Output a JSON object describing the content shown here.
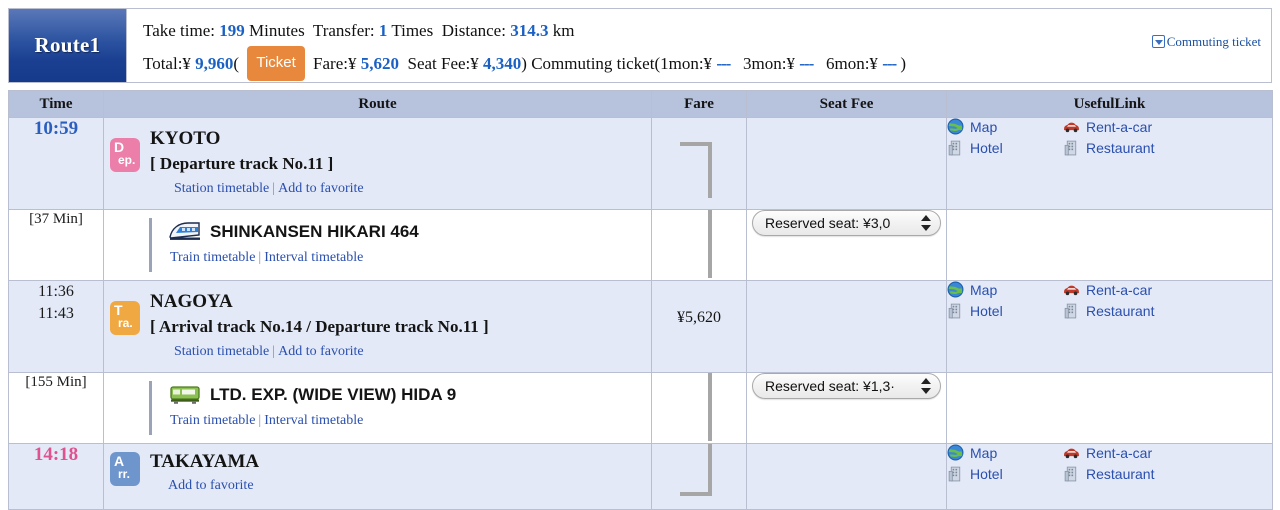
{
  "summary": {
    "route_label": "Route1",
    "take_time_label": "Take time:",
    "take_time_value": "199",
    "take_time_unit": "Minutes",
    "transfer_label": "Transfer:",
    "transfer_value": "1",
    "transfer_unit": "Times",
    "distance_label": "Distance:",
    "distance_value": "314.3",
    "distance_unit": "km",
    "total_label": "Total:¥",
    "total_value": "9,960",
    "open_paren": "(",
    "ticket_chip": "Ticket",
    "fare_label": "Fare:¥",
    "fare_value": "5,620",
    "seatfee_label": "Seat Fee:¥",
    "seatfee_value": "4,340",
    "close_paren": ")",
    "commuting_prefix": "Commuting ticket(1mon:¥",
    "commuting_1mon": "---",
    "commuting_3mon_label": "3mon:¥",
    "commuting_3mon": "---",
    "commuting_6mon_label": "6mon:¥",
    "commuting_6mon": "---",
    "commuting_suffix": ")",
    "commuting_ticket_link": "Commuting ticket"
  },
  "table": {
    "headers": {
      "time": "Time",
      "route": "Route",
      "fare": "Fare",
      "seat_fee": "Seat Fee",
      "useful_link": "UsefulLink"
    },
    "links": {
      "station_timetable": "Station timetable",
      "add_to_favorite": "Add to favorite",
      "train_timetable": "Train timetable",
      "interval_timetable": "Interval timetable",
      "separator": "|"
    },
    "useful": {
      "map": "Map",
      "rent_a_car": "Rent-a-car",
      "hotel": "Hotel",
      "restaurant": "Restaurant"
    },
    "rows": {
      "kyoto": {
        "time": "10:59",
        "marker_top": "D",
        "marker_bottom": "ep.",
        "station": "KYOTO",
        "track": "[ Departure track No.11 ]"
      },
      "leg1": {
        "duration": "[37 Min]",
        "train_name": "SHINKANSEN HIKARI 464",
        "seat_option": "Reserved seat: ¥3,0"
      },
      "nagoya": {
        "time_arrive": "11:36",
        "time_depart": "11:43",
        "marker_top": "T",
        "marker_bottom": "ra.",
        "station": "NAGOYA",
        "track": "[ Arrival track No.14 / Departure track No.11 ]",
        "fare": "¥5,620"
      },
      "leg2": {
        "duration": "[155 Min]",
        "train_name": "LTD. EXP. (WIDE VIEW) HIDA 9",
        "seat_option": "Reserved seat: ¥1,3·"
      },
      "takayama": {
        "time": "14:18",
        "marker_top": "A",
        "marker_bottom": "rr.",
        "station": "TAKAYAMA"
      }
    }
  },
  "colors": {
    "accent_blue": "#2a5fc0",
    "arrive_pink": "#e0528f",
    "ticket_orange": "#e8883c",
    "station_row_bg": "#e3e9f7",
    "header_bg": "#b7c2dd"
  }
}
